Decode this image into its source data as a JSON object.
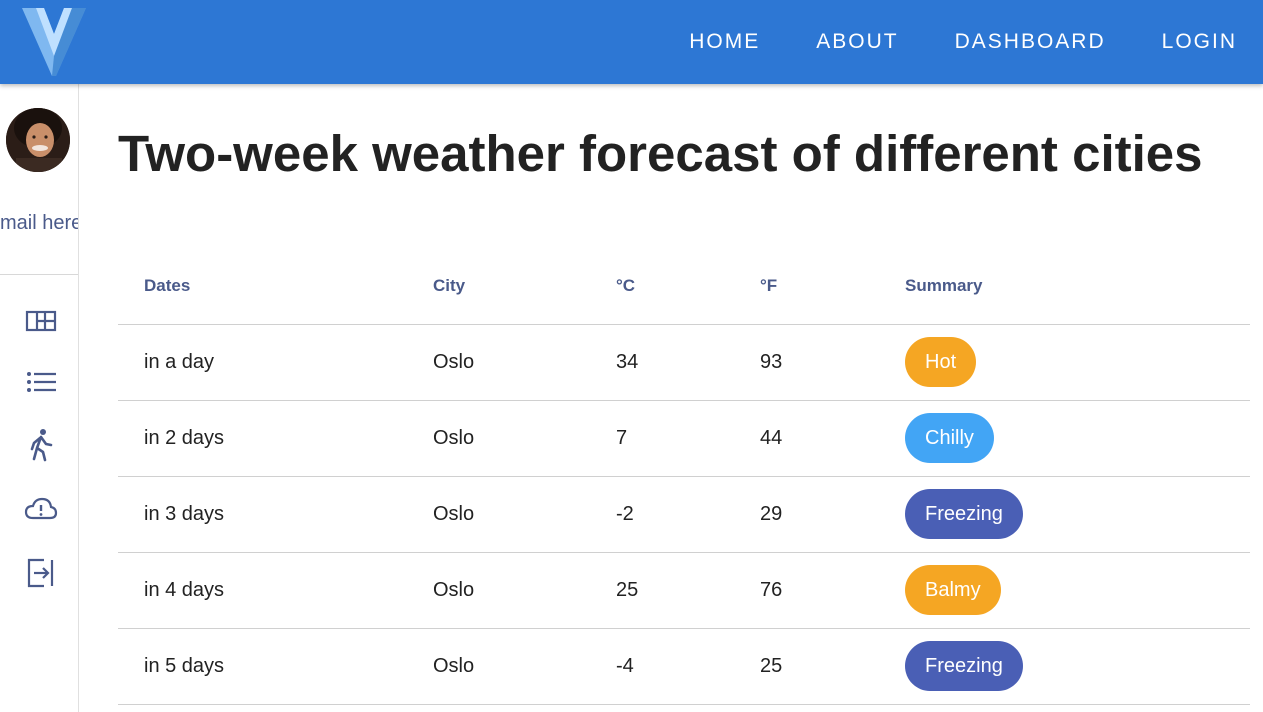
{
  "colors": {
    "header_bg": "#2d77d4",
    "hot": "#f5a623",
    "chilly": "#42a5f5",
    "freezing": "#4a5fb5",
    "balmy": "#f5a623"
  },
  "nav": {
    "items": [
      "HOME",
      "ABOUT",
      "DASHBOARD",
      "LOGIN"
    ]
  },
  "sidebar": {
    "email": "mail here",
    "icons": [
      "dashboard-icon",
      "list-icon",
      "walking-icon",
      "cloud-alert-icon",
      "exit-icon"
    ]
  },
  "main": {
    "title": "Two-week weather forecast of different cities",
    "table": {
      "headers": [
        "Dates",
        "City",
        "°C",
        "°F",
        "Summary"
      ],
      "rows": [
        {
          "date": "in a day",
          "city": "Oslo",
          "c": "34",
          "f": "93",
          "summary": "Hot",
          "color": "#f5a623"
        },
        {
          "date": "in 2 days",
          "city": "Oslo",
          "c": "7",
          "f": "44",
          "summary": "Chilly",
          "color": "#42a5f5"
        },
        {
          "date": "in 3 days",
          "city": "Oslo",
          "c": "-2",
          "f": "29",
          "summary": "Freezing",
          "color": "#4a5fb5"
        },
        {
          "date": "in 4 days",
          "city": "Oslo",
          "c": "25",
          "f": "76",
          "summary": "Balmy",
          "color": "#f5a623"
        },
        {
          "date": "in 5 days",
          "city": "Oslo",
          "c": "-4",
          "f": "25",
          "summary": "Freezing",
          "color": "#4a5fb5"
        }
      ]
    }
  }
}
